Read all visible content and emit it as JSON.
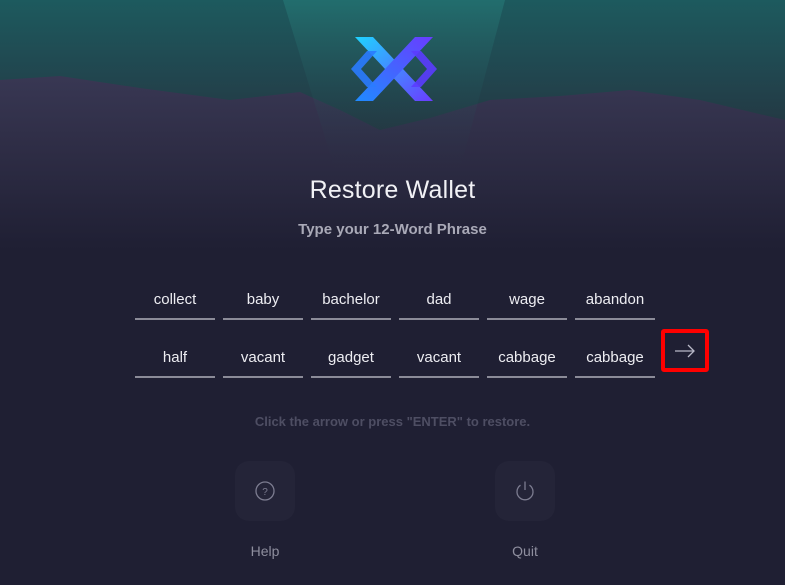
{
  "app": {
    "title": "Restore Wallet",
    "subtitle": "Type your 12-Word Phrase"
  },
  "phrase": {
    "row1": [
      "collect",
      "baby",
      "bachelor",
      "dad",
      "wage",
      "abandon"
    ],
    "row2": [
      "half",
      "vacant",
      "gadget",
      "vacant",
      "cabbage",
      "cabbage"
    ]
  },
  "hint": "Click the arrow or press \"ENTER\" to restore.",
  "actions": {
    "help_label": "Help",
    "quit_label": "Quit"
  },
  "icons": {
    "logo": "exodus-x-logo",
    "submit": "arrow-right-icon",
    "help": "question-circle-icon",
    "quit": "power-icon"
  },
  "colors": {
    "background": "#1f1f33",
    "highlight": "#ff0000",
    "logo_blue": "#1f8bff",
    "logo_purple": "#7a3cff"
  }
}
